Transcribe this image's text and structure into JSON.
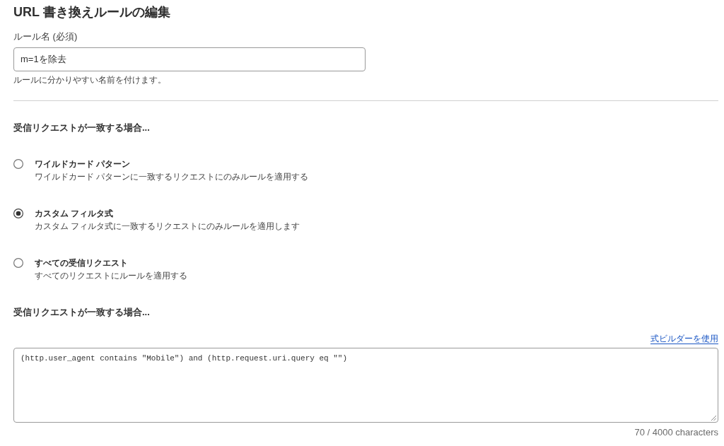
{
  "page": {
    "title": "URL 書き換えルールの編集"
  },
  "rule_name": {
    "label": "ルール名 (必須)",
    "value": "m=1を除去",
    "help": "ルールに分かりやすい名前を付けます。"
  },
  "match_section": {
    "heading": "受信リクエストが一致する場合...",
    "options": [
      {
        "title": "ワイルドカード パターン",
        "description": "ワイルドカード パターンに一致するリクエストにのみルールを適用する",
        "selected": false
      },
      {
        "title": "カスタム フィルタ式",
        "description": "カスタム フィルタ式に一致するリクエストにのみルールを適用します",
        "selected": true
      },
      {
        "title": "すべての受信リクエスト",
        "description": "すべてのリクエストにルールを適用する",
        "selected": false
      }
    ]
  },
  "expression_section": {
    "heading": "受信リクエストが一致する場合...",
    "link": "式ビルダーを使用",
    "expression": "(http.user_agent contains \"Mobile\") and (http.request.uri.query eq \"\")",
    "counter": "70 / 4000 characters"
  }
}
